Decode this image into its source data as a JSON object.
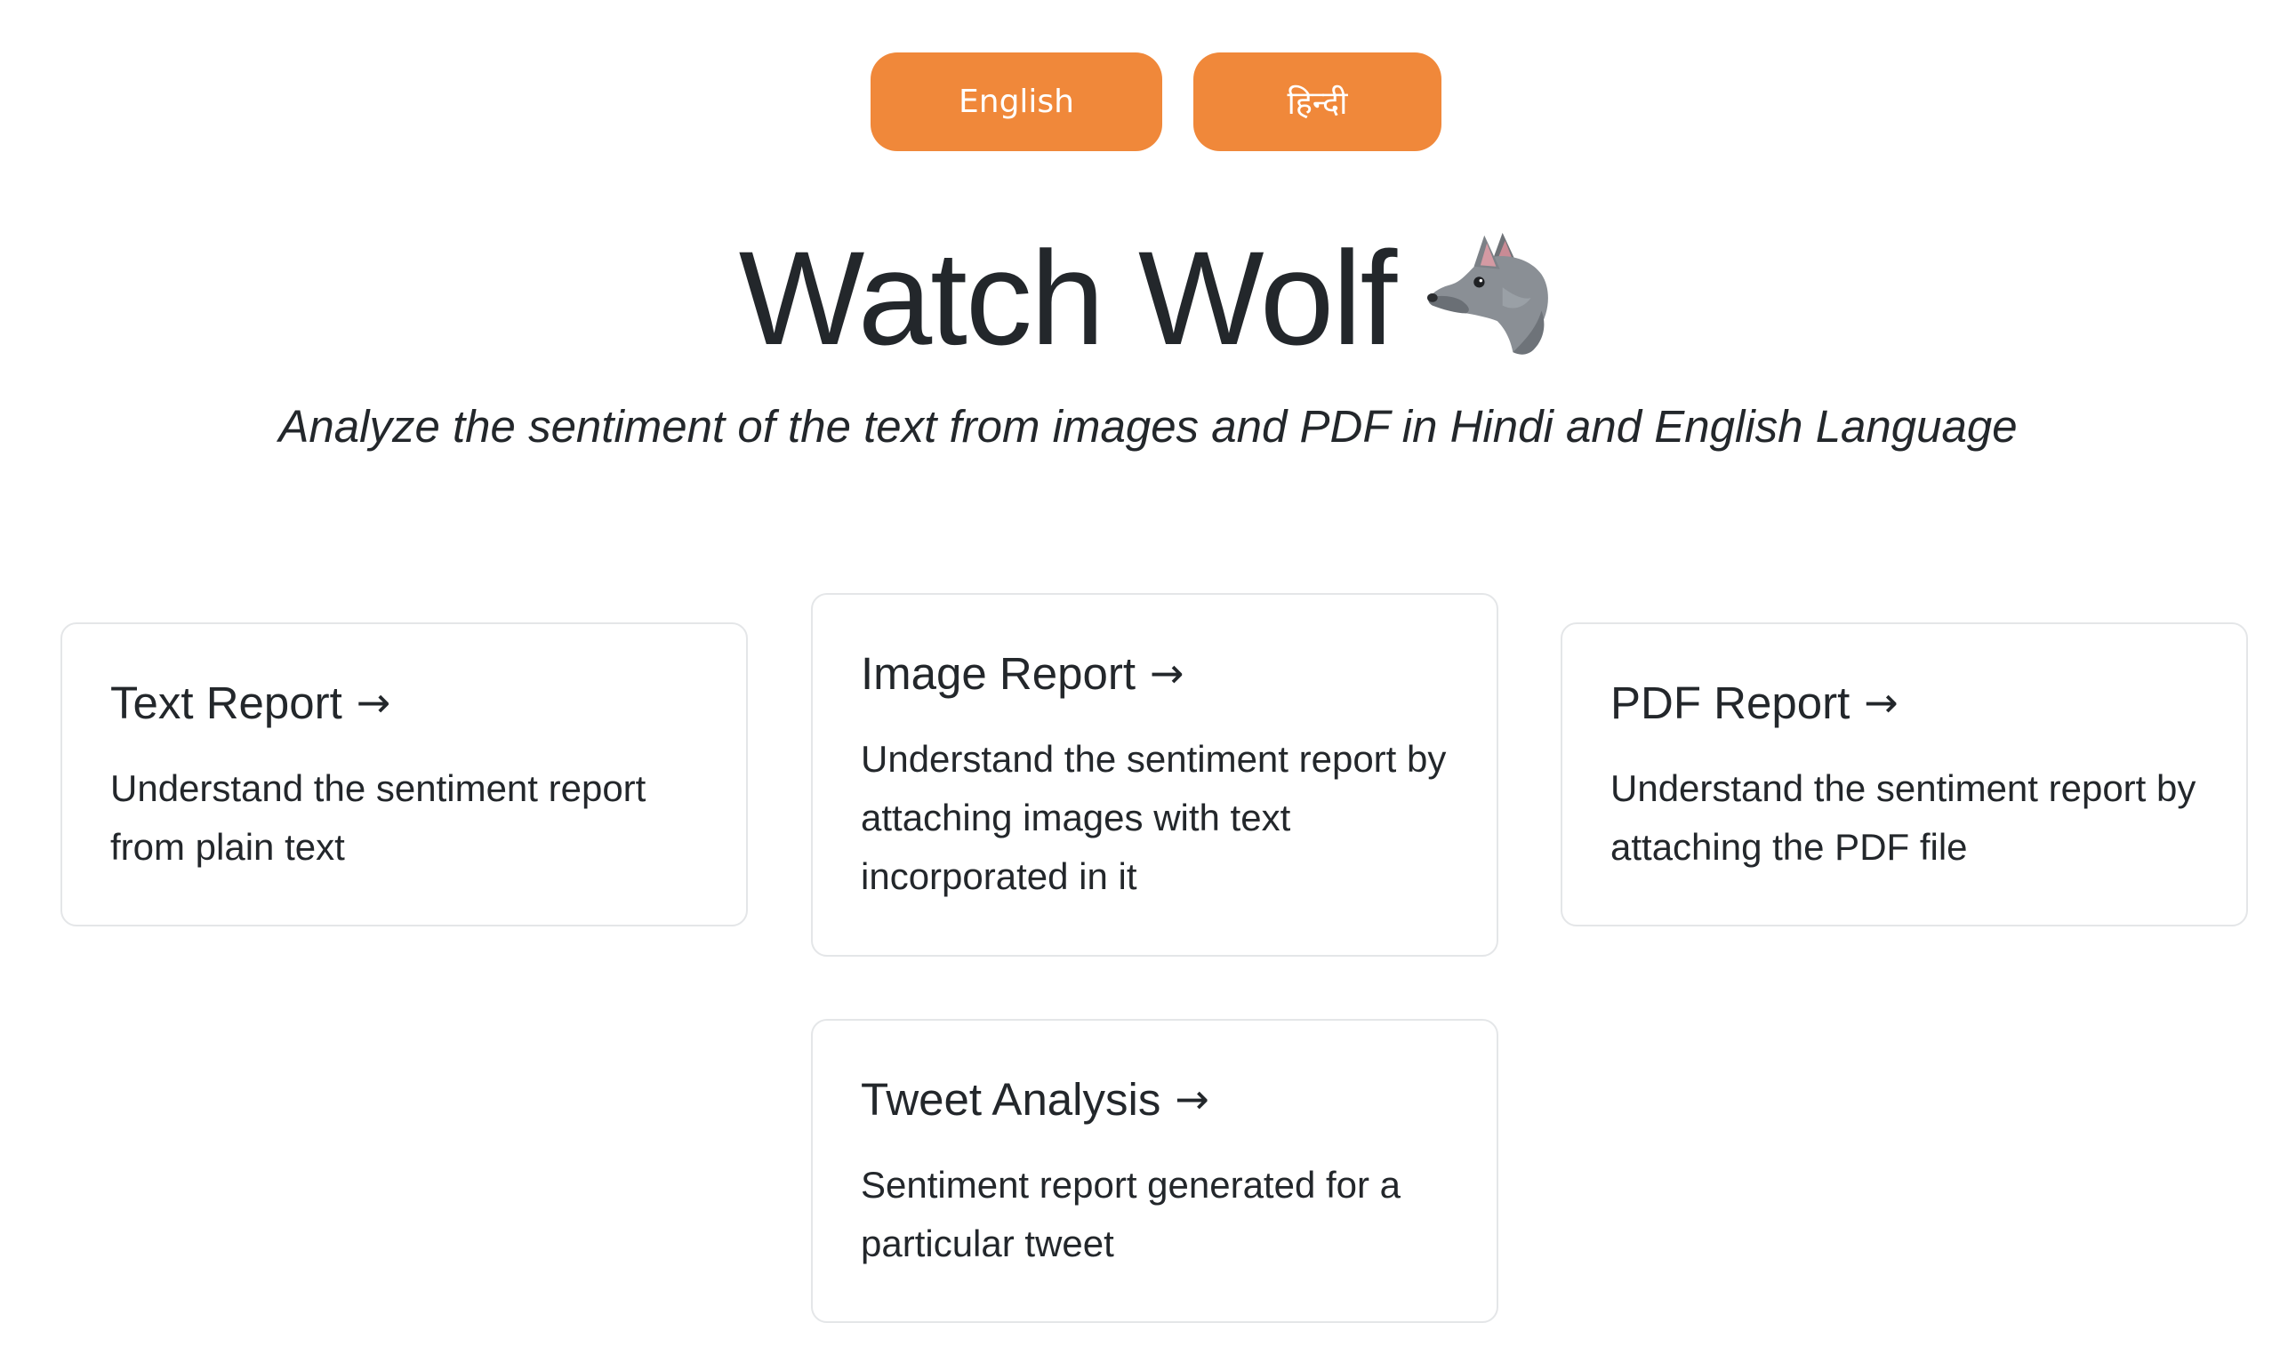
{
  "language_buttons": {
    "english": "English",
    "hindi": "हिन्दी"
  },
  "header": {
    "title": "Watch Wolf",
    "logo_icon": "wolf-icon",
    "subtitle": "Analyze the sentiment of the text from images and PDF in Hindi and English Language"
  },
  "cards": [
    {
      "title": "Text Report",
      "arrow": "→",
      "description": "Understand the sentiment report from plain text"
    },
    {
      "title": "Image Report",
      "arrow": "→",
      "description": "Understand the sentiment report by attaching images with text incorporated in it"
    },
    {
      "title": "PDF Report",
      "arrow": "→",
      "description": "Understand the sentiment report by attaching the PDF file"
    },
    {
      "title": "Tweet Analysis",
      "arrow": "→",
      "description": "Sentiment report generated for a particular tweet"
    }
  ],
  "colors": {
    "accent": "#f0883a",
    "text": "#23272b",
    "card_border": "#e4e6e8",
    "background": "#ffffff"
  }
}
